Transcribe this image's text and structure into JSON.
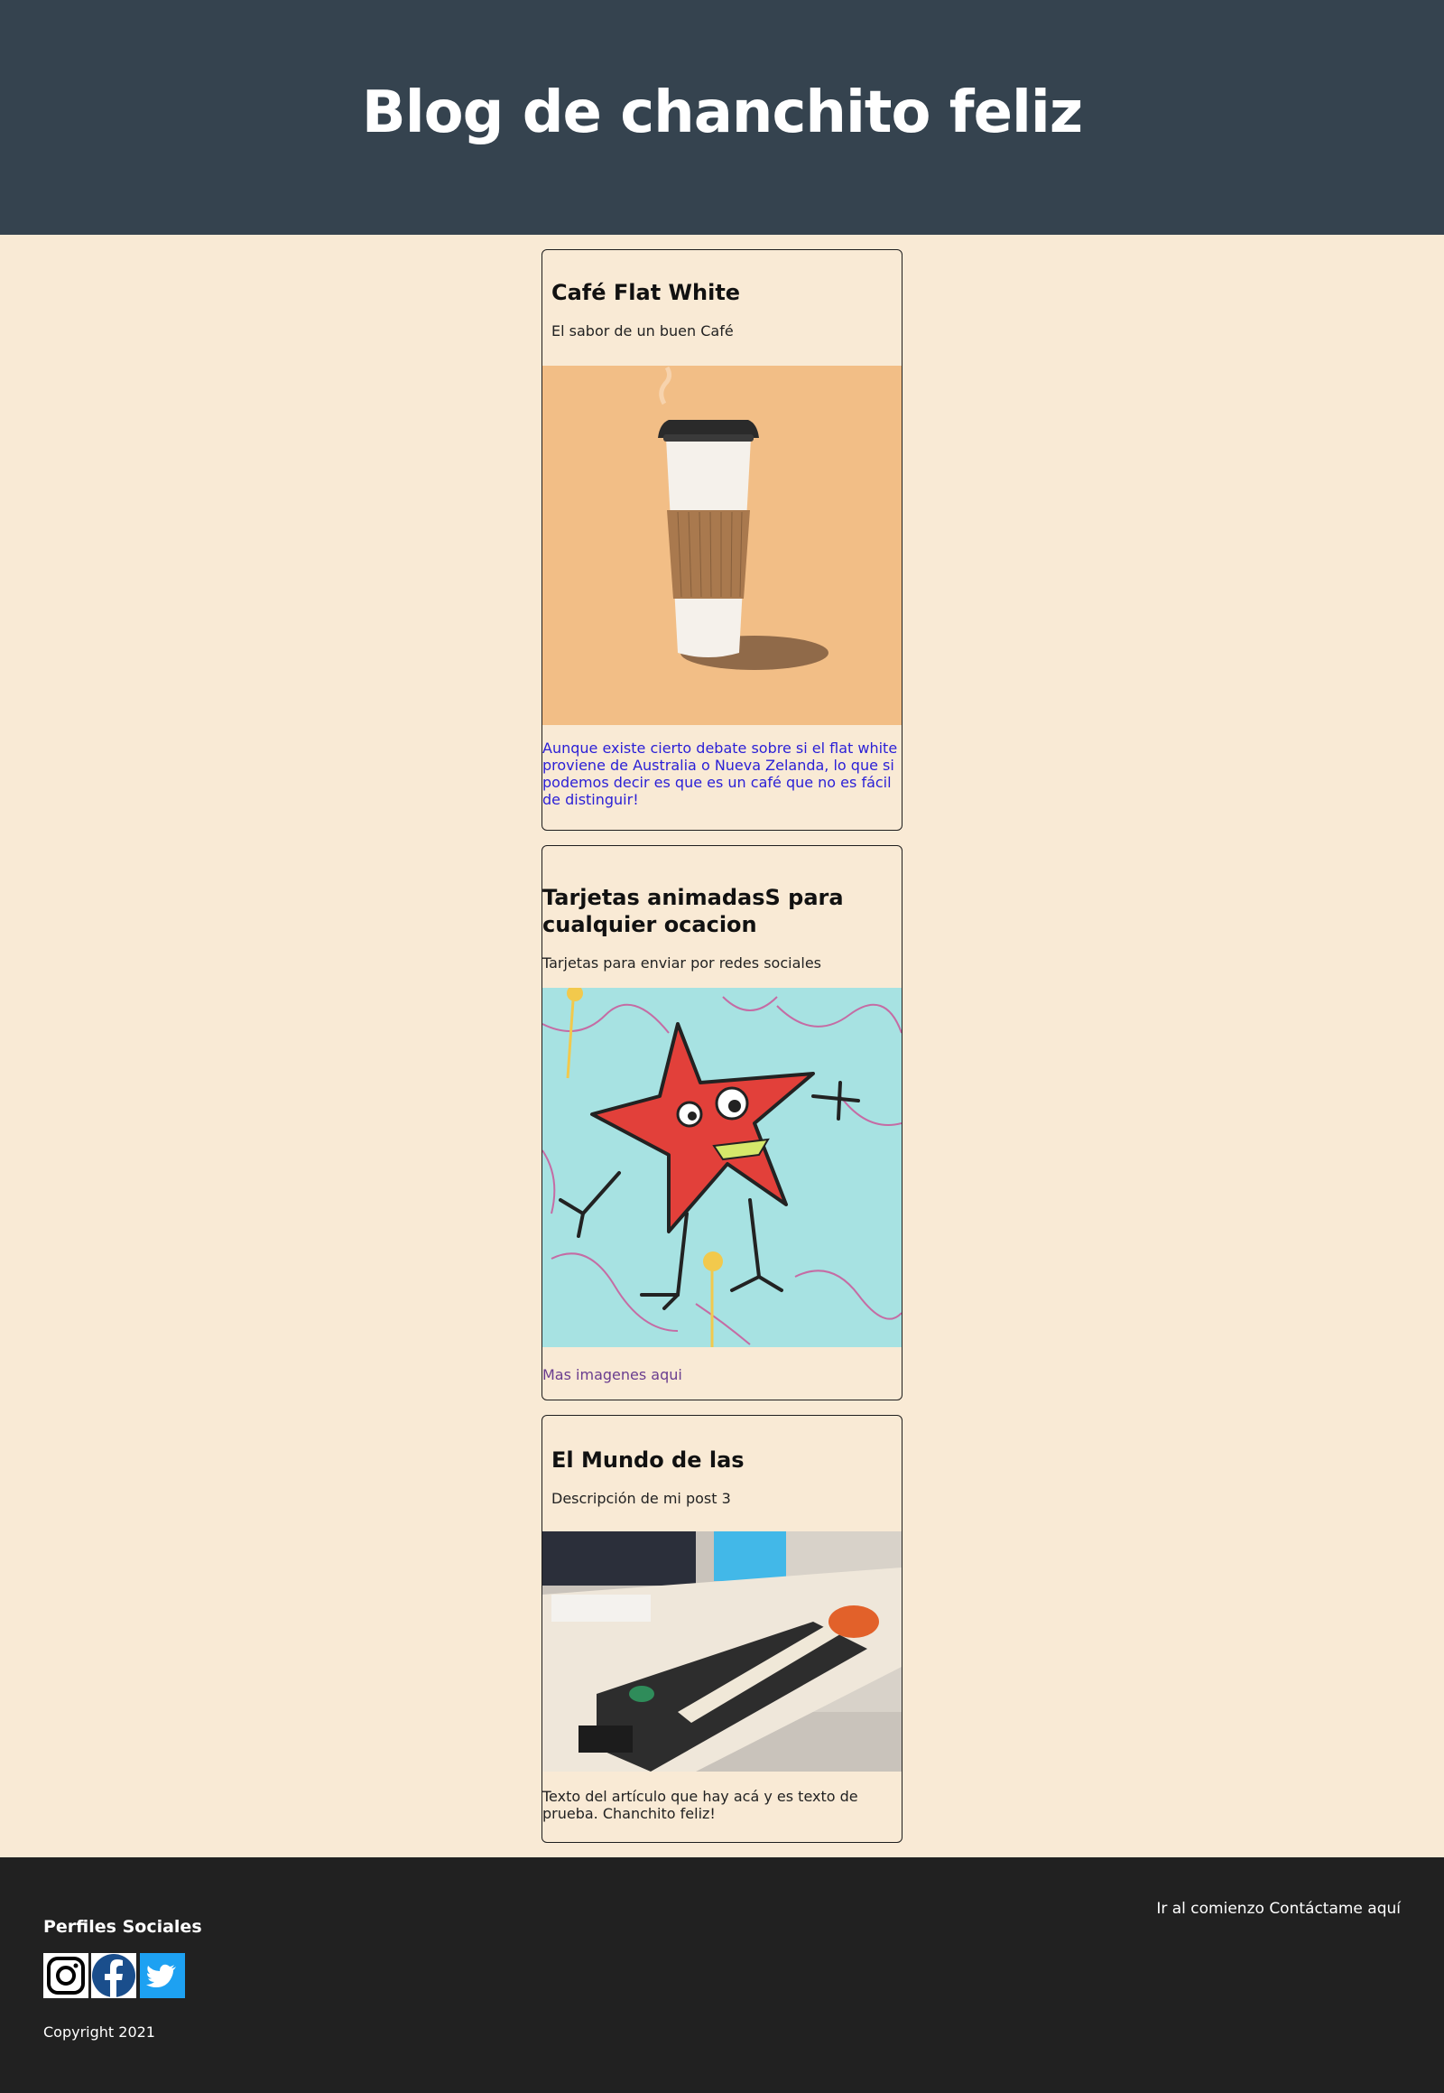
{
  "header": {
    "title": "Blog de chanchito feliz"
  },
  "posts": [
    {
      "title": "Café Flat White",
      "description": "El sabor de un buen Café",
      "image": "coffee-cup",
      "text": "Aunque existe cierto debate sobre si el flat white proviene de Australia o Nueva Zelanda, lo que si podemos decir es que es un café que no es fácil de distinguir!"
    },
    {
      "title": "Tarjetas animadasS para cualquier ocacion",
      "description": "Tarjetas para enviar por redes sociales",
      "image": "red-monster-drawing",
      "text": "Mas imagenes aqui"
    },
    {
      "title": "El Mundo de las",
      "description": "Descripción de mi post 3",
      "image": "desk-guitar-photo",
      "text": "Texto del artículo que hay acá y es texto de prueba. Chanchito feliz!"
    }
  ],
  "footer": {
    "heading": "Perfiles Sociales",
    "socials": [
      "instagram-icon",
      "facebook-icon",
      "twitter-icon"
    ],
    "copyright": "Copyright 2021",
    "links": [
      "Ir al comienzo",
      "Contáctame aquí"
    ]
  },
  "colors": {
    "header_bg": "#35434f",
    "body_bg": "#f9ead5",
    "footer_bg": "#212121",
    "link_blue": "#2a1fd6",
    "link_visited": "#6a3d8f"
  }
}
